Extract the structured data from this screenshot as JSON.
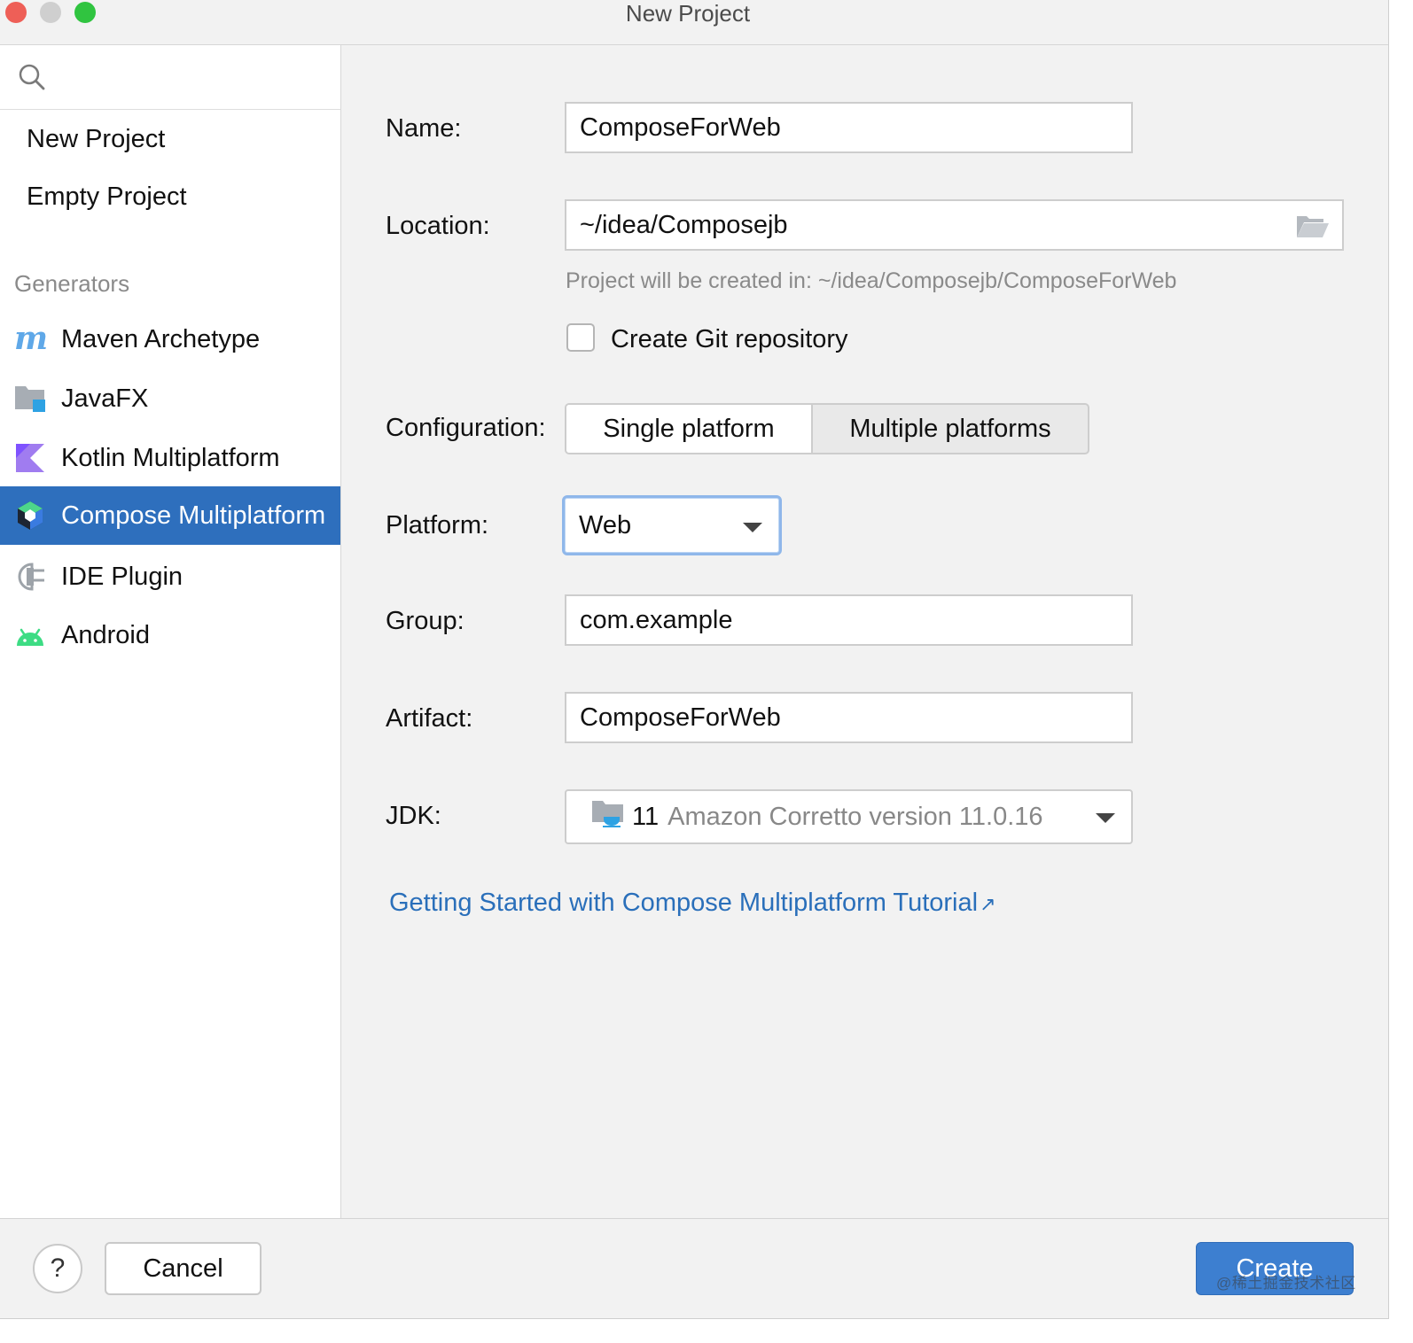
{
  "window": {
    "title": "New Project"
  },
  "sidebar": {
    "items": [
      {
        "label": "New Project",
        "icon": "none"
      },
      {
        "label": "Empty Project",
        "icon": "none"
      }
    ],
    "generators_header": "Generators",
    "generators": [
      {
        "label": "Maven Archetype",
        "icon": "maven-icon"
      },
      {
        "label": "JavaFX",
        "icon": "javafx-icon"
      },
      {
        "label": "Kotlin Multiplatform",
        "icon": "kotlin-icon"
      },
      {
        "label": "Compose Multiplatform",
        "icon": "compose-icon",
        "selected": true
      },
      {
        "label": "IDE Plugin",
        "icon": "plugin-icon"
      },
      {
        "label": "Android",
        "icon": "android-icon"
      }
    ]
  },
  "form": {
    "name": {
      "label": "Name:",
      "value": "ComposeForWeb"
    },
    "location": {
      "label": "Location:",
      "value": "~/idea/Composejb",
      "hint": "Project will be created in: ~/idea/Composejb/ComposeForWeb"
    },
    "git": {
      "label": "Create Git repository",
      "checked": false
    },
    "configuration": {
      "label": "Configuration:",
      "options": [
        "Single platform",
        "Multiple platforms"
      ],
      "selected": "Single platform"
    },
    "platform": {
      "label": "Platform:",
      "value": "Web"
    },
    "group": {
      "label": "Group:",
      "value": "com.example"
    },
    "artifact": {
      "label": "Artifact:",
      "value": "ComposeForWeb"
    },
    "jdk": {
      "label": "JDK:",
      "version": "11",
      "name": "Amazon Corretto version 11.0.16"
    },
    "tutorial_link": "Getting Started with Compose Multiplatform Tutorial"
  },
  "footer": {
    "help_label": "?",
    "cancel_label": "Cancel",
    "create_label": "Create",
    "watermark": "@稀土掘金技术社区"
  },
  "colors": {
    "selection": "#2e6fbd",
    "link": "#2a6fba",
    "primary_button": "#3d7fd0",
    "focus_ring": "#8fb7ea"
  }
}
